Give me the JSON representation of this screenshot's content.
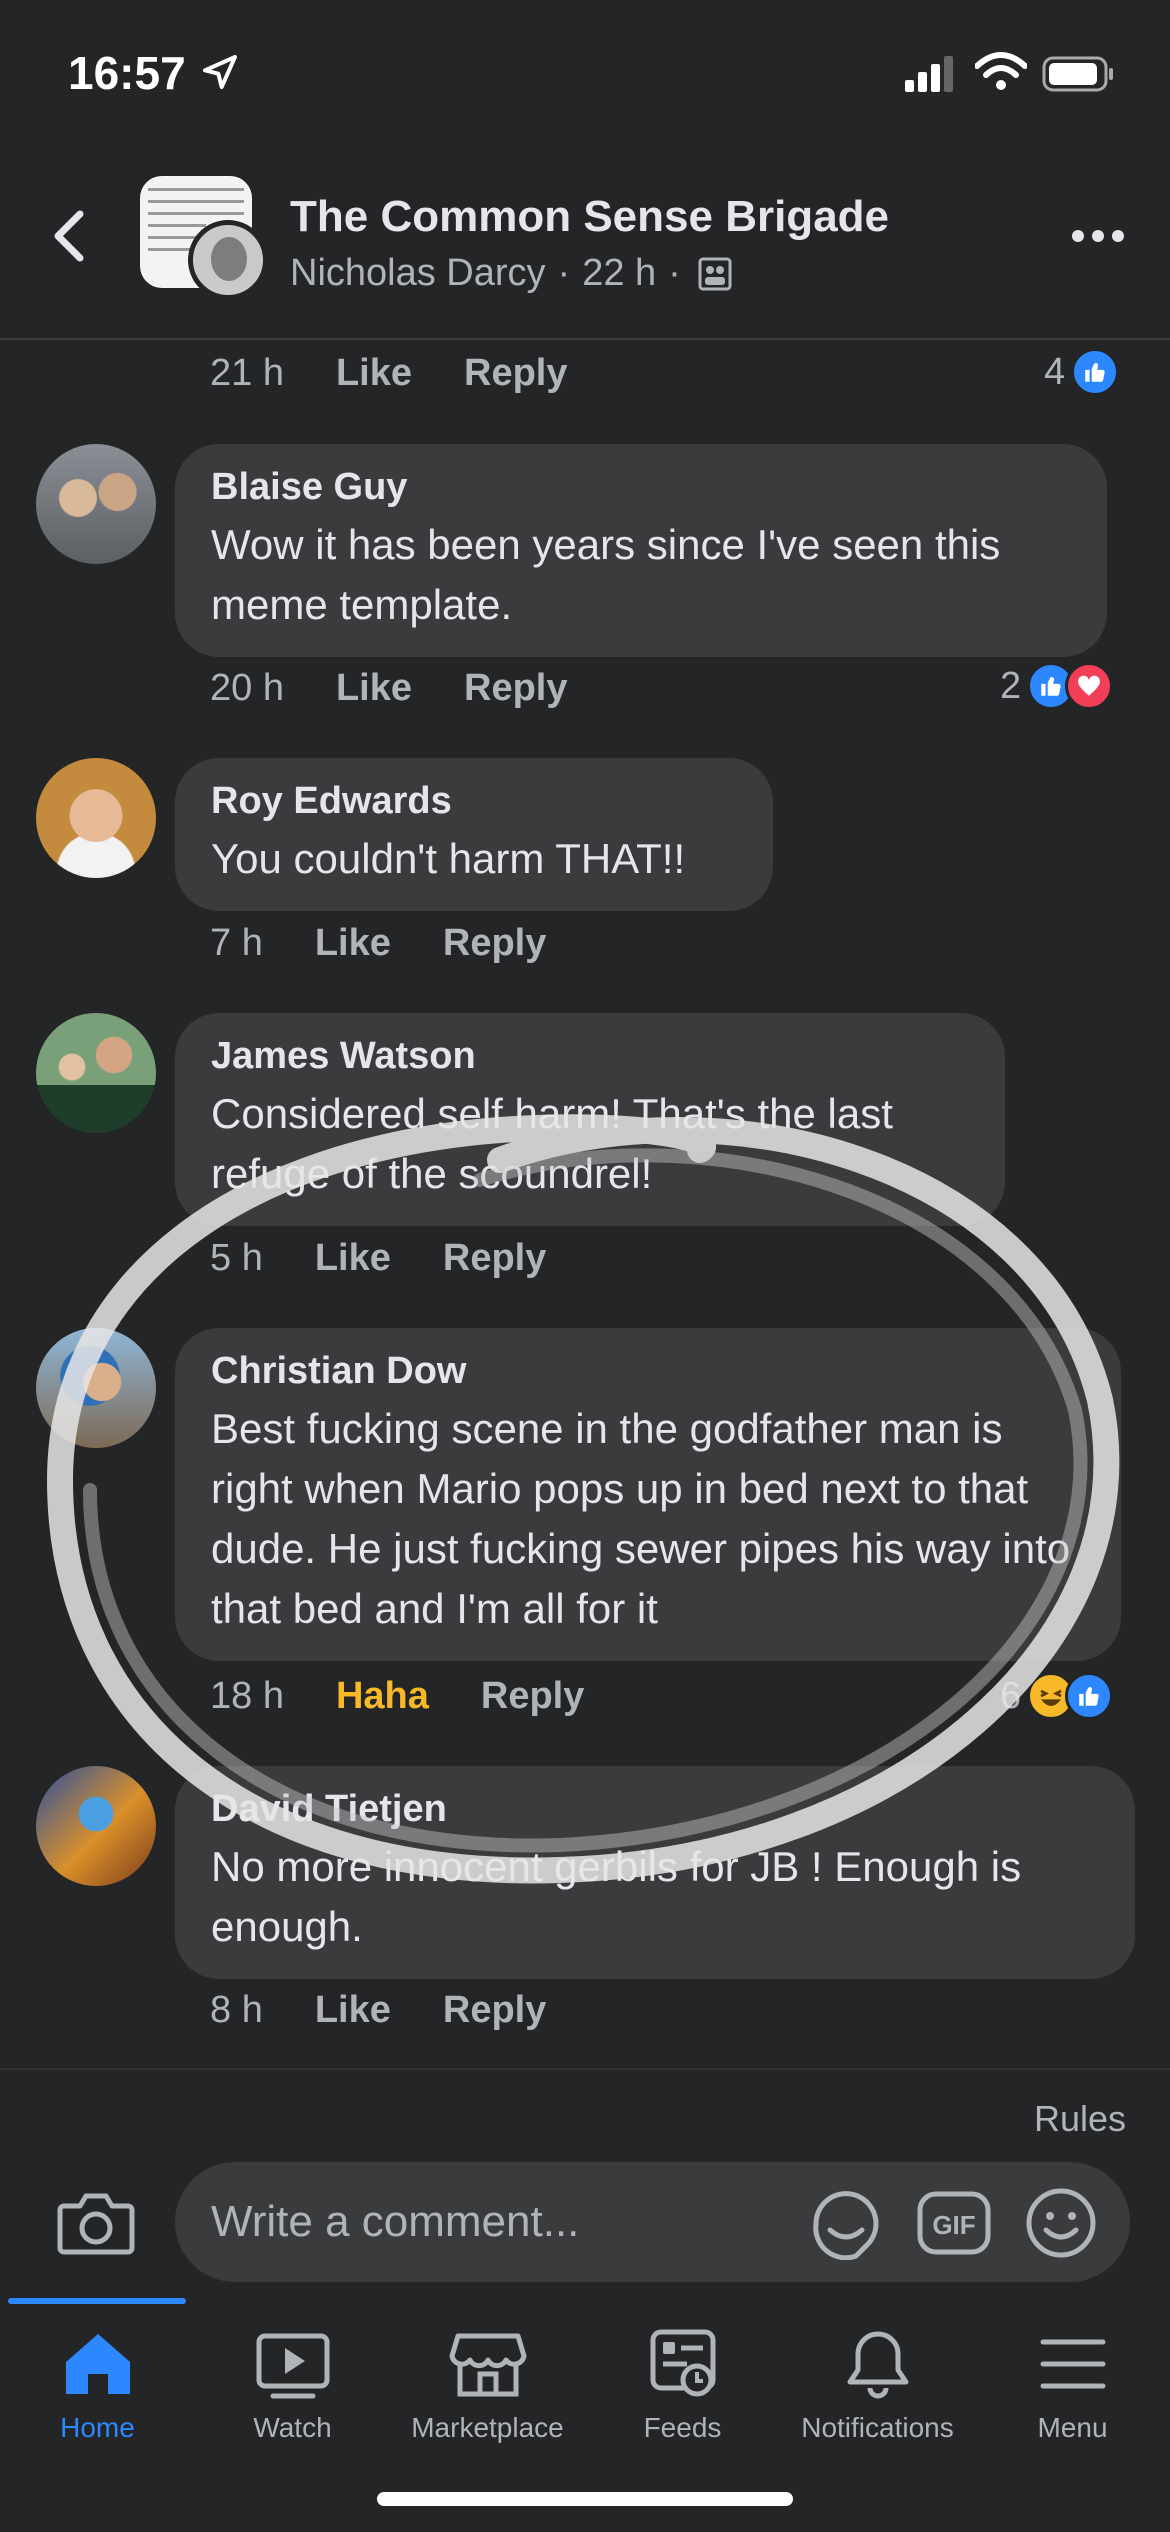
{
  "status": {
    "time": "16:57"
  },
  "header": {
    "group_name": "The Common Sense Brigade",
    "poster": "Nicholas Darcy",
    "time": "22 h",
    "separator": "·"
  },
  "top_meta": {
    "time": "21 h",
    "like": "Like",
    "reply": "Reply",
    "reaction_count": "4"
  },
  "comments": [
    {
      "author": "Blaise Guy",
      "text": "Wow it has been years since I've seen this meme template.",
      "time": "20 h",
      "like": "Like",
      "reply": "Reply",
      "reaction_count": "2"
    },
    {
      "author": "Roy Edwards",
      "text": "You couldn't harm THAT!!",
      "time": "7 h",
      "like": "Like",
      "reply": "Reply"
    },
    {
      "author": "James Watson",
      "text": "Considered self harm! That's the last refuge of the scoundrel!",
      "time": "5 h",
      "like": "Like",
      "reply": "Reply"
    },
    {
      "author": "Christian Dow",
      "text": "Best fucking scene in the godfather man is right when Mario pops up in bed next to that dude. He just fucking sewer pipes his way into that bed and I'm all for it",
      "time": "18 h",
      "like": "Haha",
      "reply": "Reply",
      "reaction_count": "6"
    },
    {
      "author": "David Tietjen",
      "text": "No more innocent gerbils for JB ! Enough is enough.",
      "time": "8 h",
      "like": "Like",
      "reply": "Reply"
    }
  ],
  "composer": {
    "rules": "Rules",
    "placeholder": "Write a comment..."
  },
  "tabs": [
    {
      "label": "Home",
      "icon": "home-icon"
    },
    {
      "label": "Watch",
      "icon": "watch-icon"
    },
    {
      "label": "Marketplace",
      "icon": "marketplace-icon"
    },
    {
      "label": "Feeds",
      "icon": "feeds-icon"
    },
    {
      "label": "Notifications",
      "icon": "bell-icon"
    },
    {
      "label": "Menu",
      "icon": "menu-icon"
    }
  ],
  "colors": {
    "accent": "#2d88ff",
    "haha": "#f7b928",
    "love": "#f33e58",
    "bubble": "#3a3b3c",
    "background": "#242526"
  }
}
